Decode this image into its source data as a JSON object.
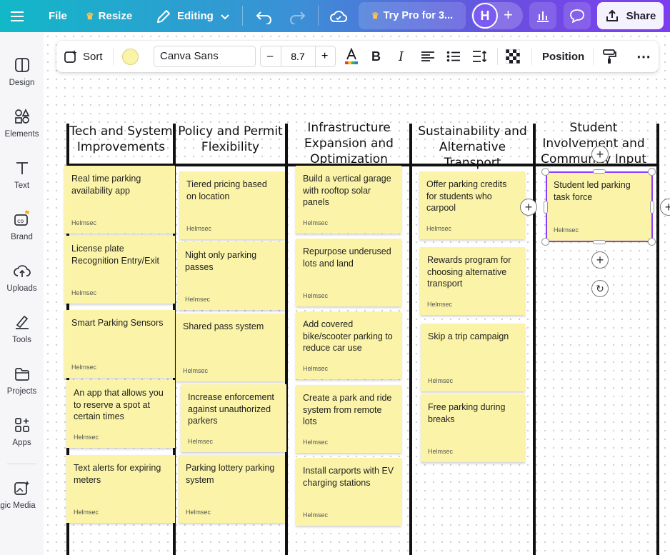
{
  "topbar": {
    "file": "File",
    "resize": "Resize",
    "editing": "Editing",
    "try_pro": "Try Pro for 3...",
    "avatar_initial": "H",
    "share": "Share"
  },
  "toolbar": {
    "sort": "Sort",
    "font_name": "Canva Sans",
    "font_minus": "–",
    "font_size": "8.7",
    "font_plus": "+",
    "bold": "B",
    "italic": "I",
    "position": "Position",
    "swatch_color": "#fbf4a8"
  },
  "sidebar": {
    "items": [
      {
        "label": "Design",
        "icon": "design-icon"
      },
      {
        "label": "Elements",
        "icon": "elements-icon"
      },
      {
        "label": "Text",
        "icon": "text-icon"
      },
      {
        "label": "Brand",
        "icon": "brand-icon"
      },
      {
        "label": "Uploads",
        "icon": "uploads-icon"
      },
      {
        "label": "Tools",
        "icon": "tools-icon"
      },
      {
        "label": "Projects",
        "icon": "projects-icon"
      },
      {
        "label": "Apps",
        "icon": "apps-icon"
      },
      {
        "label": "agic Media",
        "icon": "magic-media-icon"
      }
    ]
  },
  "board": {
    "columns": [
      {
        "title": "Tech and System Improvements",
        "notes": [
          {
            "text": "Real time parking availability app",
            "author": "Helmsec"
          },
          {
            "text": "License plate Recognition Entry/Exit",
            "author": "Helmsec"
          },
          {
            "text": "Smart Parking Sensors",
            "author": "Helmsec"
          },
          {
            "text": "An app that allows you to reserve a spot at certain times",
            "author": "Helmsec"
          },
          {
            "text": "Text alerts for expiring meters",
            "author": "Helmsec"
          }
        ]
      },
      {
        "title": "Policy and Permit Flexibility",
        "notes": [
          {
            "text": "Tiered pricing based on location",
            "author": "Helmsec"
          },
          {
            "text": "Night only parking passes",
            "author": "Helmsec"
          },
          {
            "text": "Shared pass system",
            "author": "Helmsec"
          },
          {
            "text": "Increase enforcement against unauthorized parkers",
            "author": "Helmsec"
          },
          {
            "text": "Parking lottery parking system",
            "author": "Helmsec"
          }
        ]
      },
      {
        "title": "Infrastructure Expansion and Optimization",
        "notes": [
          {
            "text": "Build a vertical garage with rooftop solar panels",
            "author": "Helmsec"
          },
          {
            "text": "Repurpose underused lots and land",
            "author": "Helmsec"
          },
          {
            "text": "Add covered bike/scooter parking to reduce car use",
            "author": "Helmsec"
          },
          {
            "text": "Create a park and ride system from remote lots",
            "author": "Helmsec"
          },
          {
            "text": "Install carports with EV charging stations",
            "author": "Helmsec"
          }
        ]
      },
      {
        "title": "Sustainability and Alternative Transport",
        "notes": [
          {
            "text": "Offer parking credits for students who carpool",
            "author": "Helmsec"
          },
          {
            "text": "Rewards program for choosing alternative transport",
            "author": "Helmsec"
          },
          {
            "text": "Skip a trip campaign",
            "author": "Helmsec"
          },
          {
            "text": "Free parking during breaks",
            "author": "Helmsec"
          }
        ]
      },
      {
        "title": "Student Involvement and Community Input",
        "notes": [
          {
            "text": "Student led parking task force",
            "author": "Helmsec"
          }
        ]
      }
    ]
  }
}
